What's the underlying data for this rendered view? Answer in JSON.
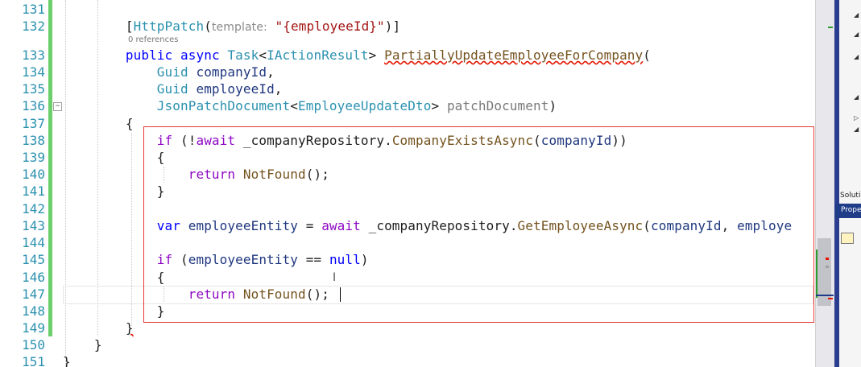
{
  "editor": {
    "line_numbers": [
      "131",
      "132",
      "",
      "133",
      "134",
      "135",
      "136",
      "137",
      "138",
      "139",
      "140",
      "141",
      "142",
      "143",
      "144",
      "145",
      "146",
      "147",
      "148",
      "149",
      "150",
      "151"
    ],
    "codelens": "0 references",
    "code": {
      "l132_attr": "HttpPatch",
      "l132_hint": "template:",
      "l132_str": "\"{employeeId}\"",
      "l133_public": "public",
      "l133_async": "async",
      "l133_task": "Task",
      "l133_iar": "IActionResult",
      "l133_method": "PartiallyUpdateEmployeeForCompany",
      "l134_type": "Guid",
      "l134_param": "companyId",
      "l135_type": "Guid",
      "l135_param": "employeeId",
      "l136_type": "JsonPatchDocument",
      "l136_generic": "EmployeeUpdateDto",
      "l136_param": "patchDocument",
      "l138_if": "if",
      "l138_await": "await",
      "l138_repo": "_companyRepository",
      "l138_method": "CompanyExistsAsync",
      "l138_arg": "companyId",
      "l140_return": "return",
      "l140_method": "NotFound",
      "l143_var": "var",
      "l143_local": "employeeEntity",
      "l143_await": "await",
      "l143_repo": "_companyRepository",
      "l143_method": "GetEmployeeAsync",
      "l143_arg1": "companyId",
      "l143_arg2": "employe",
      "l145_if": "if",
      "l145_local": "employeeEntity",
      "l145_op": "==",
      "l145_null": "null",
      "l147_return": "return",
      "l147_method": "NotFound"
    }
  },
  "right_panel": {
    "solution_label": "Solutic",
    "properties_label": "Proper"
  },
  "colors": {
    "keyword": "#0000ff",
    "control": "#8f08c4",
    "type": "#2b91af",
    "method": "#74531f",
    "string": "#a31515",
    "highlight_box": "#e53935",
    "change_bar": "#6ccf6c"
  }
}
